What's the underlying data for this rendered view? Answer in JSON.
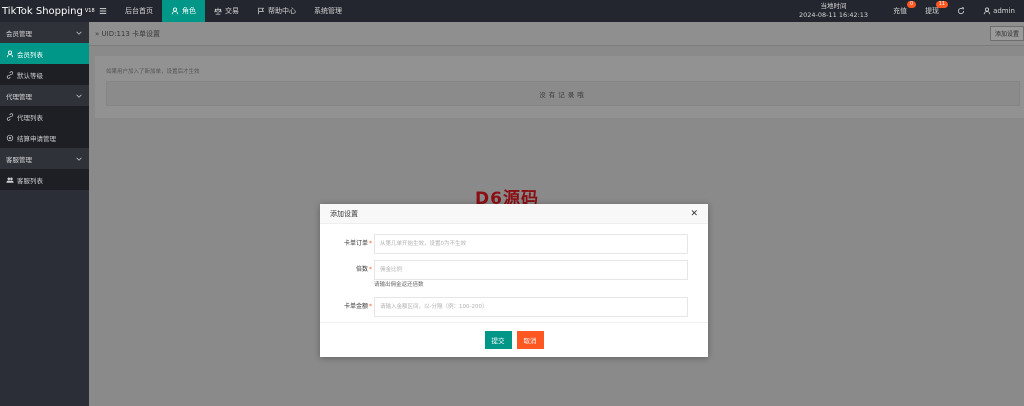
{
  "brand": {
    "name": "TikTok Shopping",
    "version": "V18"
  },
  "nav": {
    "items": [
      {
        "label": "",
        "icon": "menu-icon"
      },
      {
        "label": "后台首页",
        "icon": ""
      },
      {
        "label": "角色",
        "icon": "user-icon"
      },
      {
        "label": "交易",
        "icon": "scale-icon"
      },
      {
        "label": "帮助中心",
        "icon": "flag-icon"
      },
      {
        "label": "系统管理",
        "icon": ""
      }
    ],
    "time_label": "当地时间",
    "time_value": "2024-08-11 16:42:13",
    "recharge_label": "充值",
    "recharge_badge": "0",
    "withdraw_label": "提现",
    "withdraw_badge": "11",
    "user_label": "admin"
  },
  "sidebar": {
    "groups": [
      {
        "label": "会员管理",
        "items": [
          {
            "label": "会员列表"
          },
          {
            "label": "默认等级"
          }
        ]
      },
      {
        "label": "代理管理",
        "items": [
          {
            "label": "代理列表"
          },
          {
            "label": "结算申请管理"
          }
        ]
      },
      {
        "label": "客服管理",
        "items": [
          {
            "label": "客服列表"
          }
        ]
      }
    ]
  },
  "main": {
    "breadcrumb": "» UID:113 卡单设置",
    "add_button": "添加设置",
    "note": "如果用户加入了新加单，设置后才生效",
    "empty_text": "没有记录哦"
  },
  "watermark": "D6源码",
  "modal": {
    "title": "添加设置",
    "fields": [
      {
        "label": "卡单订单",
        "placeholder": "从第几单开始生效，设置0为不生效"
      },
      {
        "label": "倍数",
        "placeholder": "佣金比例"
      },
      {
        "label": "卡单金额",
        "placeholder": "请输入金额区间，以-分隔（例：100-200）"
      }
    ],
    "hint": "请输出佣金返还倍数",
    "submit": "提交",
    "cancel": "取消"
  },
  "colors": {
    "accent": "#009688",
    "danger": "#ff5722",
    "topbar": "#23262e",
    "sidebar": "#2b2e36"
  }
}
